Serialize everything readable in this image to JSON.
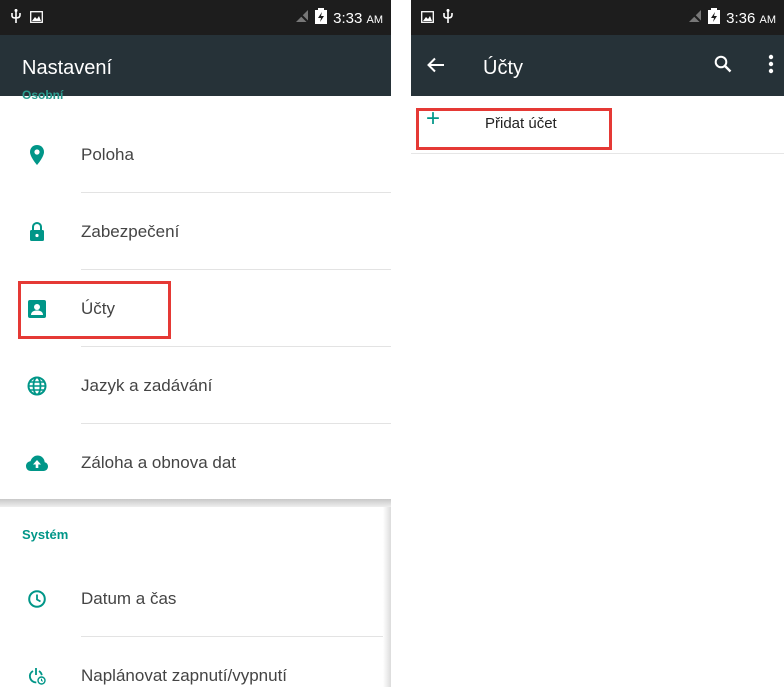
{
  "left": {
    "status": {
      "time": "3:33",
      "ampm": "AM"
    },
    "title": "Nastavení",
    "partial_header": "Osobní",
    "items": [
      {
        "label": "Poloha",
        "icon": "location-icon"
      },
      {
        "label": "Zabezpečení",
        "icon": "lock-icon"
      },
      {
        "label": "Účty",
        "icon": "account-icon"
      },
      {
        "label": "Jazyk a zadávání",
        "icon": "globe-icon"
      },
      {
        "label": "Záloha a obnova dat",
        "icon": "cloud-upload-icon"
      }
    ],
    "system_section": "Systém",
    "system_items": [
      {
        "label": "Datum a čas",
        "icon": "clock-icon"
      },
      {
        "label": "Naplánovat zapnutí/vypnutí",
        "icon": "power-schedule-icon"
      }
    ]
  },
  "right": {
    "status": {
      "time": "3:36",
      "ampm": "AM"
    },
    "title": "Účty",
    "add_account": "Přidat účet"
  },
  "colors": {
    "accent": "#009688",
    "app_bar": "#263238",
    "status_bar": "#1d1d1d",
    "highlight": "#e53935"
  }
}
